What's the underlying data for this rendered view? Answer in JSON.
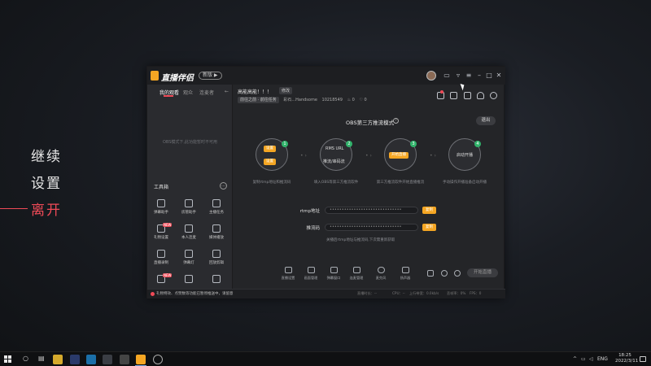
{
  "pause_menu": {
    "continue": "继续",
    "settings": "设置",
    "leave": "离开",
    "accent": "#ef4a57"
  },
  "app": {
    "logo_text": "直播伴侣",
    "version_pill": "新版 ▶",
    "sidebar": {
      "tabs": [
        "我的观看",
        "观众",
        "连麦者"
      ],
      "empty_hint": "OBS模式下,此功能暂时不可用",
      "toolbox_title": "工具箱",
      "tools": [
        {
          "label": "弹幕助手",
          "icon": "danmaku-icon"
        },
        {
          "label": "房管助手",
          "icon": "admin-icon"
        },
        {
          "label": "主播任务",
          "icon": "task-icon"
        },
        {
          "label": "礼物设置",
          "icon": "gift-icon",
          "badge": "NEW"
        },
        {
          "label": "本人连麦",
          "icon": "link-icon"
        },
        {
          "label": "媒体播放",
          "icon": "media-icon"
        },
        {
          "label": "直播录制",
          "icon": "download-icon"
        },
        {
          "label": "弹幕灯",
          "icon": "light-icon"
        },
        {
          "label": "回放剪辑",
          "icon": "clip-icon"
        },
        {
          "label": "",
          "icon": "camera-icon",
          "badge": "NEW"
        },
        {
          "label": "",
          "icon": "download-icon"
        },
        {
          "label": "",
          "icon": "mountain-icon"
        }
      ]
    },
    "header": {
      "room_title": "高能高能！！！",
      "room_tag": "修改",
      "category": "前往之前 · 前往任务",
      "streamer": "彩石...Handsome",
      "room_id": "10218549",
      "heat": "0",
      "likes": "0"
    },
    "obs": {
      "title": "OBS第三方推流模式",
      "exit": "退出",
      "steps": [
        {
          "num": "1",
          "btn1": "设置",
          "btn2": "设置",
          "caption": "复制rtmp地址和推流码"
        },
        {
          "num": "2",
          "text1": "RMS URL",
          "text2": "推流/串码流",
          "caption": "填入OBS等第三方推流软件"
        },
        {
          "num": "3",
          "btn1": "开始直播",
          "caption": "第三方推流软件开始直播推流"
        },
        {
          "num": "4",
          "text1": "启动开播",
          "caption": "手动操作开播准备启动开播"
        }
      ],
      "rtmp_label": "rtmp地址",
      "rtmp_value": "••••••••••••••••••••••••••••••",
      "key_label": "推流码",
      "key_value": "••••••••••••••••••••••••••••••",
      "copy": "复制",
      "hint": "关播后rtmp地址与推流码,下次需重新获取"
    },
    "bottom_tools": [
      "直播设置",
      "画面管理",
      "弹幕窗口",
      "连麦管理",
      "麦克风",
      "扬声器"
    ],
    "start_live": "开始直播",
    "status": {
      "message": "礼物特效、点赞数等功能已暂停推送中，请留意",
      "stats": [
        "直播时长：--",
        "CPU：--",
        "上行带宽：0.0kb/s",
        "丢帧率：0%",
        "FPS：0"
      ]
    }
  },
  "taskbar": {
    "lang": "ENG",
    "time": "18:25",
    "date": "2022/3/11"
  }
}
